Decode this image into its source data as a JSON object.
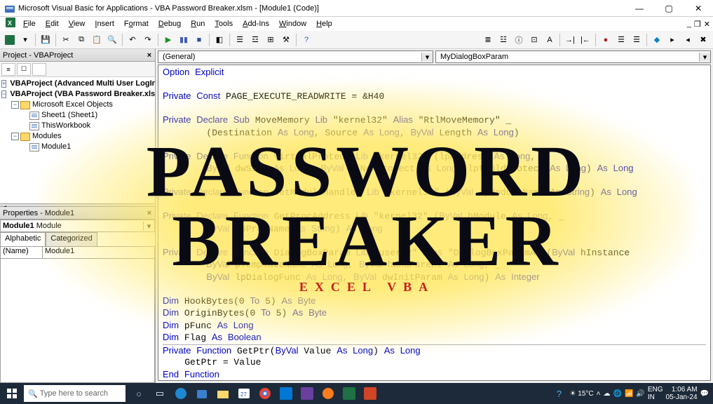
{
  "window": {
    "title": "Microsoft Visual Basic for Applications - VBA Password Breaker.xlsm - [Module1 (Code)]"
  },
  "menu": {
    "items": [
      "File",
      "Edit",
      "View",
      "Insert",
      "Format",
      "Debug",
      "Run",
      "Tools",
      "Add-Ins",
      "Window",
      "Help"
    ]
  },
  "project": {
    "header": "Project - VBAProject",
    "nodes": {
      "p1": "VBAProject (Advanced Multi User LogIn.xlsx)",
      "p2": "VBAProject (VBA Password Breaker.xlsm)",
      "excel_objects": "Microsoft Excel Objects",
      "sheet1": "Sheet1 (Sheet1)",
      "wb": "ThisWorkbook",
      "modules": "Modules",
      "mod1": "Module1"
    }
  },
  "properties": {
    "header": "Properties - Module1",
    "object_name": "Module1",
    "object_type": "Module",
    "tab_alpha": "Alphabetic",
    "tab_cat": "Categorized",
    "row_key": "(Name)",
    "row_val": "Module1"
  },
  "code": {
    "left_dd": "(General)",
    "right_dd": "MyDialogBoxParam",
    "lines": [
      "Option Explicit",
      "",
      "Private Const PAGE_EXECUTE_READWRITE = &H40",
      "",
      "Private Declare Sub MoveMemory Lib \"kernel32\" Alias \"RtlMoveMemory\" _",
      "        (Destination As Long, Source As Long, ByVal Length As Long)",
      "",
      "Private Declare Function VirtualProtect Lib \"kernel32\" (lpAddress As Long, _",
      "        ByVal dwSize As Long, ByVal flNewProtect As Long, lpflOldProtect As Long) As Long",
      "",
      "Private Declare Function GetModuleHandleA Lib \"kernel32\" (ByVal lpModuleName As String) As Long",
      "",
      "Private Declare Function GetProcAddress Lib \"kernel32\" (ByVal hModule As Long, _",
      "        ByVal lpProcName As String) As Long",
      "",
      "Private Declare Function DialogBoxParam Lib \"user32\" Alias \"DialogBoxParamA\" (ByVal hInstance",
      "        ByVal pTemplateName As Long, ByVal hWndParent As Long, _",
      "        ByVal lpDialogFunc As Long, ByVal dwInitParam As Long) As Integer",
      "",
      "Dim HookBytes(0 To 5) As Byte",
      "Dim OriginBytes(0 To 5) As Byte",
      "Dim pFunc As Long",
      "Dim Flag As Boolean",
      "---HR---",
      "Private Function GetPtr(ByVal Value As Long) As Long",
      "    GetPtr = Value",
      "End Function",
      "---HR---"
    ]
  },
  "overlay": {
    "line1": "PASSWORD",
    "line2": "BREAKER",
    "sub": "EXCEL VBA"
  },
  "taskbar": {
    "search_placeholder": "Type here to search",
    "weather": "15°C",
    "lang1": "ENG",
    "lang2": "IN",
    "time": "1:06 AM",
    "date": "05-Jan-24"
  }
}
